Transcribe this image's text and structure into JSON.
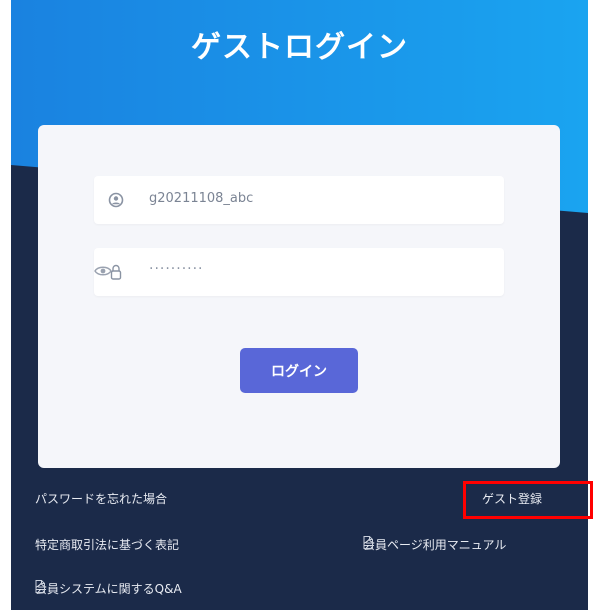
{
  "page": {
    "title": "ゲストログイン"
  },
  "form": {
    "username_value": "g20211108_abc",
    "password_mask": "··········",
    "login_label": "ログイン"
  },
  "links": {
    "forgot_password": "パスワードを忘れた場合",
    "guest_register": "ゲスト登録",
    "commercial_law": "特定商取引法に基づく表記",
    "member_manual": "会員ページ利用マニュアル",
    "member_qa": "会員システムに関するQ&A"
  },
  "colors": {
    "header_blue": "#1b86e3",
    "navy": "#1b2a49",
    "button": "#5967d8",
    "highlight": "#ff0000"
  }
}
